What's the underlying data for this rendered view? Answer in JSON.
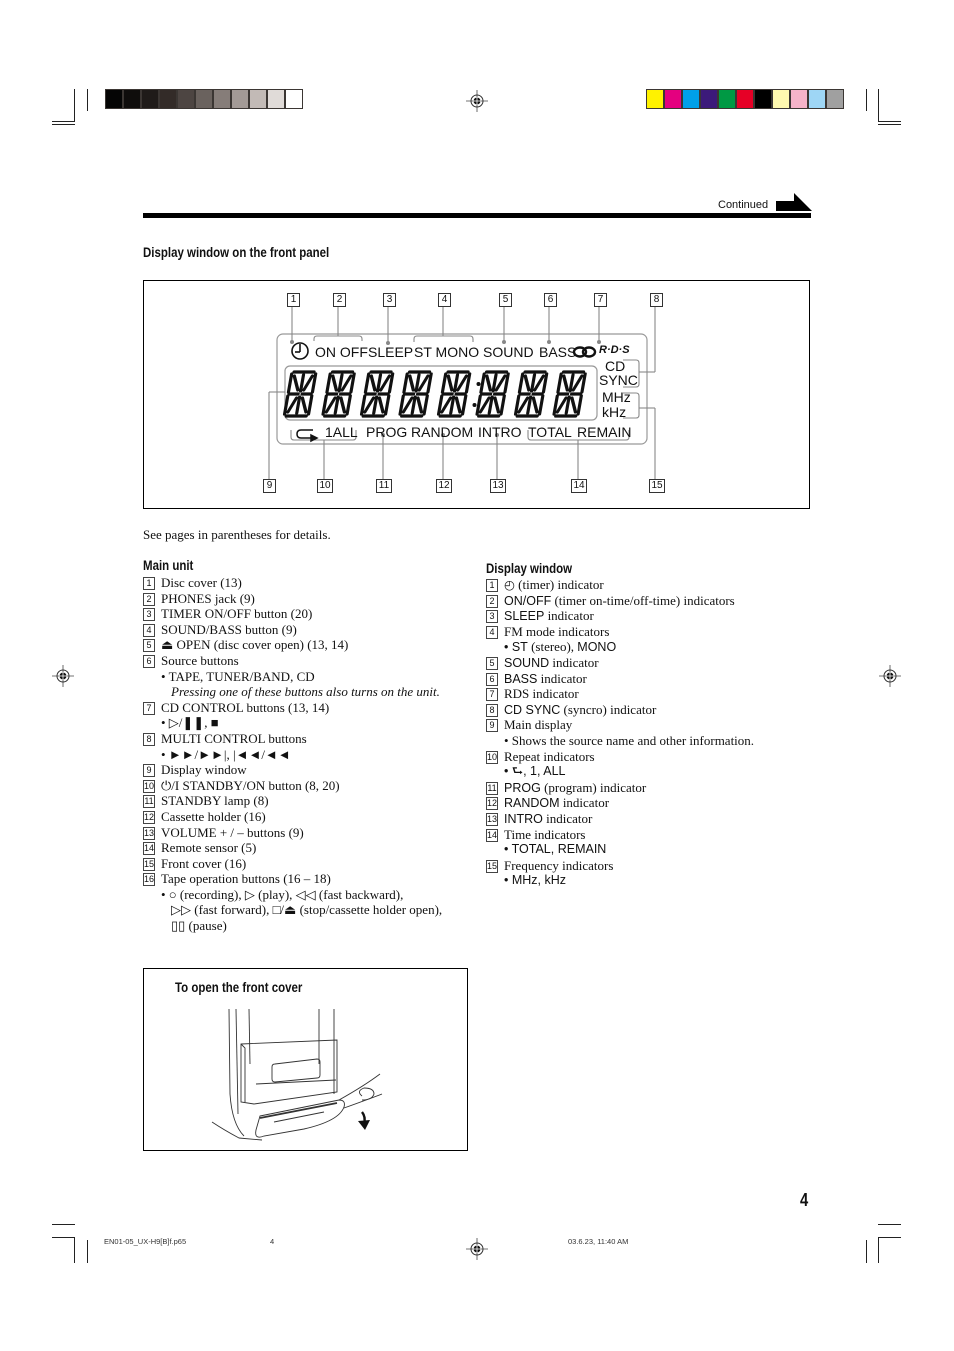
{
  "print_marks": {
    "grayscale_swatches": [
      "#050505",
      "#0f0d0c",
      "#1f1b19",
      "#332b28",
      "#4d4542",
      "#6a625e",
      "#867d79",
      "#a39a96",
      "#c2bab6",
      "#e0dbd8",
      "#ffffff"
    ],
    "color_swatches": [
      "#fff200",
      "#e4007f",
      "#00a0e9",
      "#3c1a7a",
      "#009944",
      "#e60026",
      "#000000",
      "#fff9b0",
      "#f6b3c9",
      "#9ed6f5",
      "#a0a0a0"
    ]
  },
  "header": {
    "continued_label": "Continued"
  },
  "diagram": {
    "title": "Display window on the front panel",
    "callouts_top": [
      "1",
      "2",
      "3",
      "4",
      "5",
      "6",
      "7",
      "8"
    ],
    "callouts_bottom": [
      "9",
      "10",
      "11",
      "12",
      "13",
      "14",
      "15"
    ],
    "top_indicators": {
      "on_off": "ON OFF",
      "sleep": "SLEEP",
      "st_mono": "ST MONO",
      "sound": "SOUND",
      "bass": "BASS",
      "rds": "R·D·S"
    },
    "right_indicators": {
      "cd": "CD",
      "sync": "SYNC",
      "mhz": "MHz",
      "khz": "kHz"
    },
    "bottom_indicators": {
      "one_all": "1ALL",
      "prog": "PROG",
      "random": "RANDOM",
      "intro": "INTRO",
      "total": "TOTAL",
      "remain": "REMAIN"
    },
    "segment_digits": 8
  },
  "note": "See pages in parentheses for details.",
  "main_unit": {
    "title": "Main unit",
    "items": [
      {
        "n": "1",
        "text": "Disc cover (13)"
      },
      {
        "n": "2",
        "text": "PHONES jack (9)"
      },
      {
        "n": "3",
        "text": "TIMER ON/OFF button (20)"
      },
      {
        "n": "4",
        "text": "SOUND/BASS button (9)"
      },
      {
        "n": "5",
        "text": "⏏ OPEN (disc cover open) (13, 14)"
      },
      {
        "n": "6",
        "text": "Source buttons"
      },
      {
        "sub": "• TAPE, TUNER/BAND, CD"
      },
      {
        "sub_italic": "Pressing one of these buttons also turns on the unit."
      },
      {
        "n": "7",
        "text": "CD CONTROL buttons (13, 14)"
      },
      {
        "sub": "• ▷/❚❚, ■"
      },
      {
        "n": "8",
        "text": "MULTI CONTROL buttons"
      },
      {
        "sub": "• ►►/►►|, |◄◄/◄◄"
      },
      {
        "n": "9",
        "text": "Display window"
      },
      {
        "n": "10",
        "text": "⏻/I STANDBY/ON button (8, 20)"
      },
      {
        "n": "11",
        "text": "STANDBY lamp (8)"
      },
      {
        "n": "12",
        "text": "Cassette holder (16)"
      },
      {
        "n": "13",
        "text": "VOLUME + / – buttons (9)"
      },
      {
        "n": "14",
        "text": "Remote sensor (5)"
      },
      {
        "n": "15",
        "text": "Front cover (16)"
      },
      {
        "n": "16",
        "text": "Tape operation buttons (16 – 18)"
      },
      {
        "sub": "• ○ (recording), ▷ (play), ◁◁ (fast backward),"
      },
      {
        "sub2": "▷▷ (fast forward), □/⏏ (stop/cassette holder open),"
      },
      {
        "sub2": "▯▯ (pause)"
      }
    ]
  },
  "display_window": {
    "title": "Display window",
    "items": [
      {
        "n": "1",
        "lead": "◴",
        "text": " (timer) indicator"
      },
      {
        "n": "2",
        "lead": "ON/OFF",
        "text": " (timer on-time/off-time) indicators"
      },
      {
        "n": "3",
        "lead": "SLEEP",
        "text": " indicator"
      },
      {
        "n": "4",
        "lead": "",
        "text": "FM mode indicators"
      },
      {
        "sub_lead": "• ST",
        "sub_text": " (stereo), ",
        "sub_tail": "MONO"
      },
      {
        "n": "5",
        "lead": "SOUND",
        "text": " indicator"
      },
      {
        "n": "6",
        "lead": "BASS",
        "text": " indicator"
      },
      {
        "n": "7",
        "lead": "",
        "text": "RDS indicator"
      },
      {
        "n": "8",
        "lead": "CD SYNC",
        "text": " (syncro) indicator"
      },
      {
        "n": "9",
        "lead": "",
        "text": "Main display"
      },
      {
        "sub_serif": "• Shows the source name and other information."
      },
      {
        "n": "10",
        "lead": "",
        "text": "Repeat indicators"
      },
      {
        "sub_sans": "• ⮑, 1, ALL"
      },
      {
        "n": "11",
        "lead": "PROG",
        "text": " (program) indicator"
      },
      {
        "n": "12",
        "lead": "RANDOM",
        "text": " indicator"
      },
      {
        "n": "13",
        "lead": "INTRO",
        "text": " indicator"
      },
      {
        "n": "14",
        "lead": "",
        "text": "Time indicators"
      },
      {
        "sub_sans": "• TOTAL, REMAIN"
      },
      {
        "n": "15",
        "lead": "",
        "text": "Frequency indicators"
      },
      {
        "sub_sans": "• MHz, kHz"
      }
    ]
  },
  "front_cover": {
    "title": "To open the front cover"
  },
  "page_number": "4",
  "footer": {
    "file": "EN01-05_UX-H9[B]f.p65",
    "page": "4",
    "timestamp": "03.6.23, 11:40 AM"
  }
}
